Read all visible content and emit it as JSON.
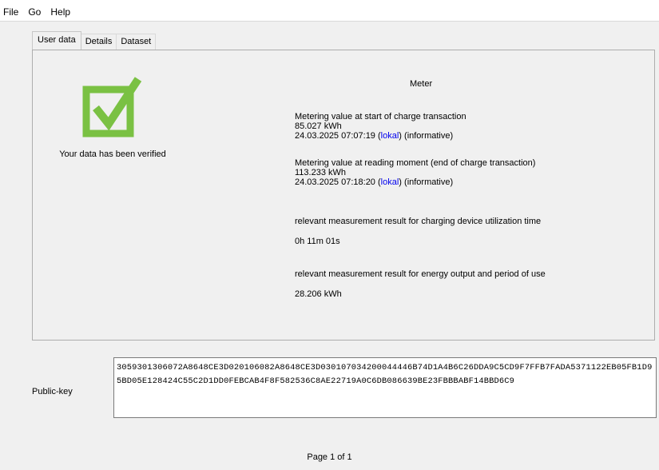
{
  "menu": [
    "File",
    "Go",
    "Help"
  ],
  "tabs": [
    {
      "label": "User data",
      "active": true
    },
    {
      "label": "Details",
      "active": false
    },
    {
      "label": "Dataset",
      "active": false
    }
  ],
  "status": {
    "icon": "check-icon",
    "icon_color": "#7ac143",
    "message": "Your data has been verified"
  },
  "meter": {
    "title": "Meter",
    "start": {
      "label": "Metering value at start of charge transaction",
      "value": "85.027 kWh",
      "timestamp": "24.03.2025 07:07:19",
      "open_paren": "(",
      "zone_link": "lokal",
      "close_text": ")",
      "note": "(informative)"
    },
    "end": {
      "label": "Metering value at reading moment (end of charge transaction)",
      "value": "113.233 kWh",
      "timestamp": "24.03.2025 07:18:20",
      "open_paren": "(",
      "zone_link": "lokal",
      "close_text": ")",
      "note": "(informative)"
    },
    "duration": {
      "label": "relevant measurement result for charging device utilization time",
      "value": "0h 11m 01s"
    },
    "energy": {
      "label": "relevant measurement result for energy output and period of use",
      "value": "28.206 kWh"
    }
  },
  "public_key": {
    "label": "Public-key",
    "value": "3059301306072A8648CE3D020106082A8648CE3D030107034200044446B74D1A4B6C26DDA9C5CD9F7FFB7FADA5371122EB05FB1D95BD05E128424C55C2D1DD0FEBCAB4F8F582536C8AE22719A0C6DB086639BE23FBBBABF14BBD6C9"
  },
  "pagination": "Page 1 of 1",
  "colors": {
    "link": "#0000ee",
    "check": "#7ac143"
  }
}
